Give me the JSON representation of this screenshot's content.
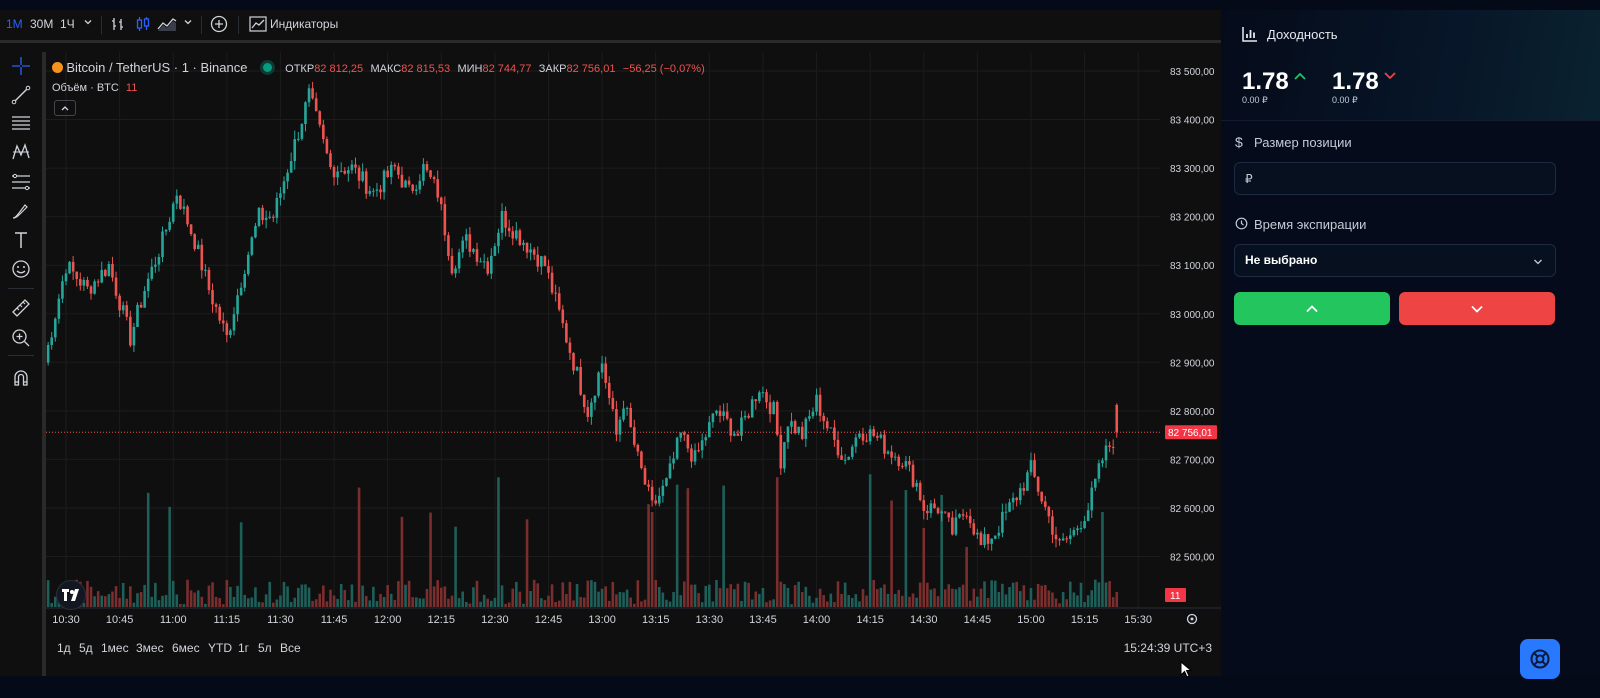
{
  "toolbar": {
    "intervals": [
      "1М",
      "30М",
      "1Ч"
    ],
    "active_interval": "1М",
    "indicators_label": "Индикаторы"
  },
  "legend": {
    "symbol": "Bitcoin / TetherUS · 1 · Binance",
    "open_label": "ОТКР",
    "open": "82 812,25",
    "high_label": "МАКС",
    "high": "82 815,53",
    "low_label": "МИН",
    "low": "82 744,77",
    "close_label": "ЗАКР",
    "close": "82 756,01",
    "change": "−56,25 (−0,07%)",
    "volume_label": "Объём · BTC",
    "volume_value": "11"
  },
  "chart_data": {
    "type": "candlestick",
    "symbol": "BTCUSDT",
    "interval": "1m",
    "time_range": [
      "10:24",
      "15:24"
    ],
    "ylim": [
      82400,
      83550
    ],
    "y_ticks": [
      "83 500,00",
      "83 400,00",
      "83 300,00",
      "83 200,00",
      "83 100,00",
      "83 000,00",
      "82 900,00",
      "82 800,00",
      "82 700,00",
      "82 600,00",
      "82 500,00"
    ],
    "x_ticks": [
      "10:30",
      "10:45",
      "11:00",
      "11:15",
      "11:30",
      "11:45",
      "12:00",
      "12:15",
      "12:30",
      "12:45",
      "13:00",
      "13:15",
      "13:30",
      "13:45",
      "14:00",
      "14:15",
      "14:30",
      "14:45",
      "15:00",
      "15:15",
      "15:30"
    ],
    "x_tick_times_min": [
      30,
      45,
      60,
      75,
      90,
      105,
      120,
      135,
      150,
      165,
      180,
      195,
      210,
      225,
      240,
      255,
      270,
      285,
      300,
      315,
      330
    ],
    "close_path": {
      "t_min": [
        24,
        30,
        36,
        42,
        48,
        52,
        57,
        61,
        66,
        70,
        75,
        80,
        84,
        88,
        92,
        98,
        104,
        110,
        116,
        122,
        126,
        130,
        134,
        138,
        142,
        148,
        152,
        158,
        164,
        170,
        176,
        180,
        184,
        186,
        190,
        194,
        198,
        202,
        206,
        212,
        218,
        224,
        228,
        230,
        232,
        236,
        240,
        244,
        248,
        252,
        256,
        260,
        264,
        268,
        270,
        274,
        278,
        282,
        286,
        290,
        294,
        298,
        300,
        304,
        308,
        312,
        316,
        320,
        324
      ],
      "close": [
        82900,
        83100,
        83050,
        83100,
        82950,
        83050,
        83150,
        83250,
        83150,
        83050,
        82950,
        83100,
        83200,
        83200,
        83300,
        83450,
        83300,
        83300,
        83250,
        83300,
        83250,
        83300,
        83250,
        83100,
        83150,
        83100,
        83200,
        83150,
        83100,
        82950,
        82800,
        82900,
        82750,
        82820,
        82700,
        82600,
        82650,
        82750,
        82700,
        82800,
        82750,
        82850,
        82800,
        82700,
        82780,
        82750,
        82820,
        82750,
        82700,
        82760,
        82750,
        82720,
        82700,
        82650,
        82600,
        82600,
        82550,
        82600,
        82520,
        82550,
        82600,
        82650,
        82680,
        82600,
        82520,
        82550,
        82600,
        82700,
        82756.01
      ]
    },
    "last_price": "82 756,01",
    "last_volume": "11",
    "grid": true,
    "timezone": "UTC+3",
    "colors": {
      "up": "#26a69a",
      "down": "#ef5350",
      "vol_up": "#1e5f59",
      "vol_down": "#7a2e2e"
    }
  },
  "bottom": {
    "ranges": [
      "1д",
      "5д",
      "1мес",
      "3мес",
      "6мес",
      "YTD",
      "1г",
      "5л",
      "Все"
    ],
    "clock": "15:24:39 UTC+3"
  },
  "panel": {
    "title": "Доходность",
    "payout_up": "1.78",
    "payout_up_sub": "0.00 ₽",
    "payout_down": "1.78",
    "payout_down_sub": "0.00 ₽",
    "position_label": "Размер позиции",
    "position_placeholder": "₽",
    "expiration_label": "Время экспирации",
    "expiration_value": "Не выбрано"
  }
}
